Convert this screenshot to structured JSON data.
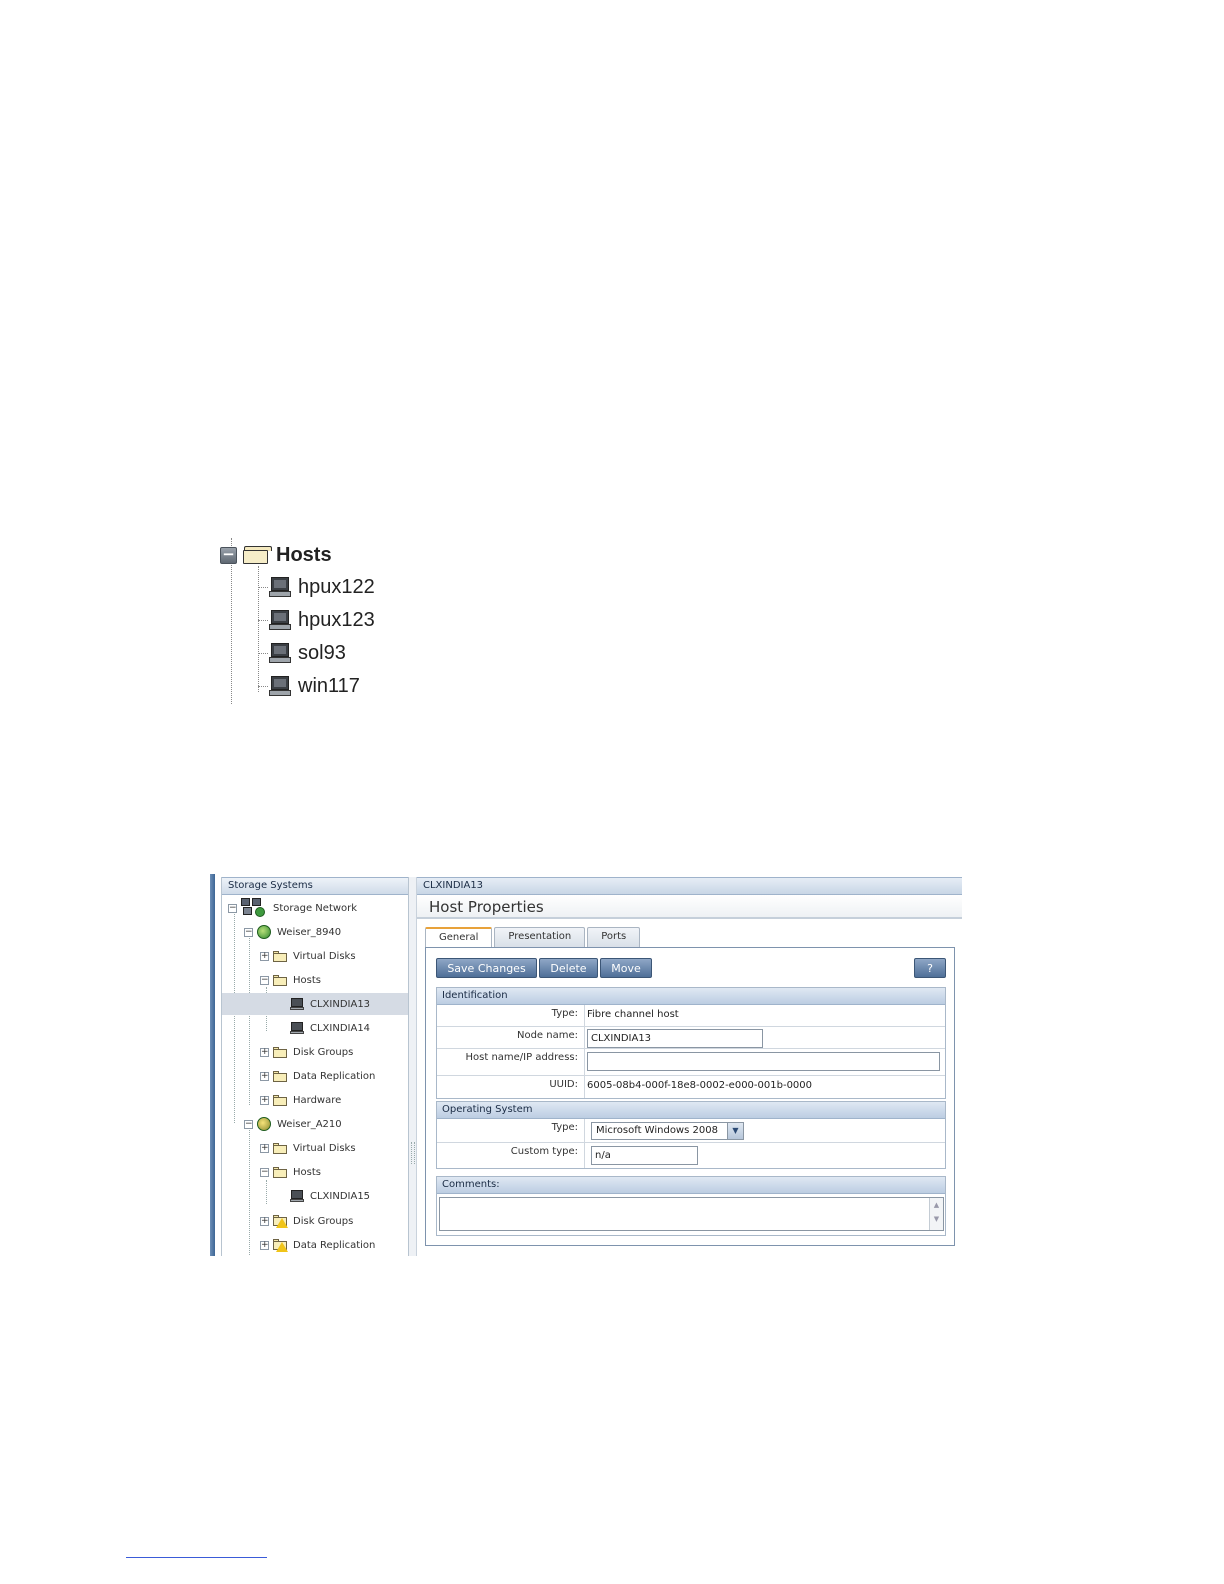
{
  "hosts_tree": {
    "root_label": "Hosts",
    "hosts": [
      "hpux122",
      "hpux123",
      "sol93",
      "win117"
    ]
  },
  "command_view": {
    "nav": {
      "header": "Storage Systems",
      "items": [
        {
          "label": "Storage Network",
          "icon": "storage-network-icon",
          "expander": "−"
        },
        {
          "label": "Weiser_8940",
          "icon": "storage-system-ok-icon",
          "expander": "−"
        },
        {
          "label": "Virtual Disks",
          "icon": "folder-icon",
          "expander": "+"
        },
        {
          "label": "Hosts",
          "icon": "folder-icon",
          "expander": "−"
        },
        {
          "label": "CLXINDIA13",
          "icon": "host-computer-icon",
          "selected": true
        },
        {
          "label": "CLXINDIA14",
          "icon": "host-computer-icon"
        },
        {
          "label": "Disk Groups",
          "icon": "folder-icon",
          "expander": "+"
        },
        {
          "label": "Data Replication",
          "icon": "folder-icon",
          "expander": "+"
        },
        {
          "label": "Hardware",
          "icon": "folder-icon",
          "expander": "+"
        },
        {
          "label": "Weiser_A210",
          "icon": "storage-system-warning-icon",
          "expander": "−"
        },
        {
          "label": "Virtual Disks",
          "icon": "folder-icon",
          "expander": "+"
        },
        {
          "label": "Hosts",
          "icon": "folder-icon",
          "expander": "−"
        },
        {
          "label": "CLXINDIA15",
          "icon": "host-computer-icon"
        },
        {
          "label": "Disk Groups",
          "icon": "folder-warning-icon",
          "expander": "+"
        },
        {
          "label": "Data Replication",
          "icon": "folder-warning-icon",
          "expander": "+"
        }
      ]
    },
    "title_bar": "CLXINDIA13",
    "page_title": "Host Properties",
    "tabs": [
      "General",
      "Presentation",
      "Ports"
    ],
    "active_tab": "General",
    "buttons": {
      "save": "Save Changes",
      "delete": "Delete",
      "move": "Move",
      "help": "?"
    },
    "identification": {
      "header": "Identification",
      "type_label": "Type:",
      "type_value": "Fibre channel host",
      "node_name_label": "Node name:",
      "node_name_value": "CLXINDIA13",
      "host_label": "Host name/IP address:",
      "host_value": "",
      "uuid_label": "UUID:",
      "uuid_value": "6005-08b4-000f-18e8-0002-e000-001b-0000"
    },
    "operating_system": {
      "header": "Operating System",
      "type_label": "Type:",
      "type_value": "Microsoft Windows 2008",
      "custom_label": "Custom type:",
      "custom_value": "n/a"
    },
    "comments": {
      "header": "Comments:",
      "value": ""
    },
    "colors": {
      "button_blue": "#4f6f98",
      "section_header": "#bccde2",
      "selection": "#d5dbe4",
      "active_tab_accent": "#e8a23a"
    }
  }
}
